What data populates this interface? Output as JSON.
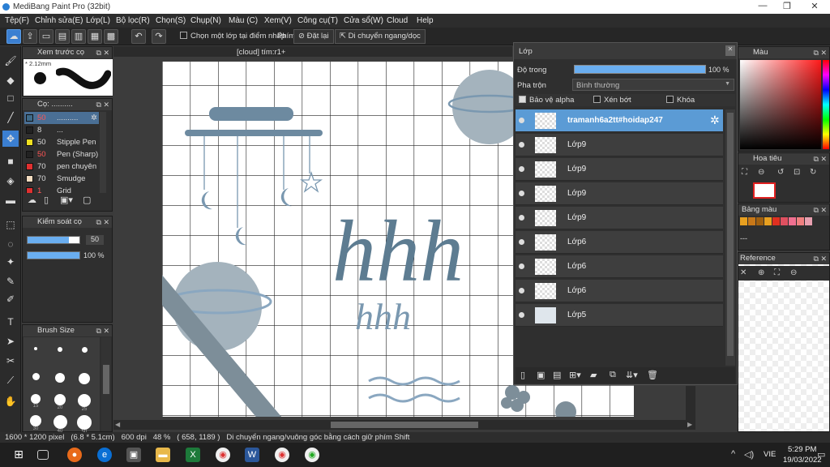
{
  "window": {
    "title": "MediBang Paint Pro (32bit)"
  },
  "menu": [
    "Tệp(F)",
    "Chỉnh sửa(E)",
    "Lớp(L)",
    "Bộ lọc(R)",
    "Chọn(S)",
    "Chụp(N)",
    "Màu (C)",
    "Xem(V)",
    "Công cụ(T)",
    "Cửa sổ(W)",
    "Cloud",
    "Help"
  ],
  "toolbar": {
    "select_layer_label": "Chọn một lớp tại điểm nhấp",
    "key_label": "Phím",
    "reset_label": "Đặt lại",
    "move_hv_label": "Di chuyển ngang/dọc"
  },
  "canvas": {
    "tab_title": "[cloud] tím:r1+"
  },
  "brush_preview": {
    "title": "Xem trước cọ",
    "size": "2.12mm"
  },
  "brush_panel": {
    "title": "Cọ: ..........",
    "items": [
      {
        "num": "50",
        "label": "..........",
        "color": "#3e6b8a",
        "selected": true
      },
      {
        "num": "8",
        "label": "...",
        "color": "#222222"
      },
      {
        "num": "50",
        "label": "Stipple Pen",
        "color": "#f0e020"
      },
      {
        "num": "50",
        "label": "Pen (Sharp)",
        "color": "#222222"
      },
      {
        "num": "70",
        "label": "pen chuyên",
        "color": "#e03030"
      },
      {
        "num": "70",
        "label": "Smudge",
        "color": "#f2dcc0"
      },
      {
        "num": "1",
        "label": "Grid",
        "color": "#e03030"
      }
    ]
  },
  "brush_control": {
    "title": "Kiểm soát cọ",
    "size": "50",
    "opacity": "100 %"
  },
  "brush_size": {
    "title": "Brush Size",
    "sizes": [
      "",
      "",
      "",
      "",
      "",
      "",
      "15",
      "20",
      "25",
      "30",
      "40",
      "50"
    ]
  },
  "layers": {
    "title": "Lớp",
    "opacity_label": "Độ trong",
    "opacity_value": "100 %",
    "blend_label": "Pha trộn",
    "blend_value": "Bình thường",
    "protect_alpha": "Bảo vệ alpha",
    "clipping": "Xén bớt",
    "lock": "Khóa",
    "items": [
      "tramanh6a2tt#hoidap247",
      "Lớp9",
      "Lớp9",
      "Lớp9",
      "Lớp9",
      "Lớp6",
      "Lớp6",
      "Lớp6",
      "Lớp5"
    ]
  },
  "right_panels": {
    "color": "Màu",
    "navigator": "Hoa tiêu",
    "palette": "Bảng màu",
    "palette_text": "---",
    "reference": "Reference"
  },
  "palette_colors": [
    "#e8a020",
    "#c87818",
    "#a06010",
    "#e03020",
    "#e05060",
    "#f07090",
    "#f08080",
    "#e8a0b0"
  ],
  "status": {
    "text": "1600 * 1200 pixel   (6.8 * 5.1cm)   600 dpi   48 %   ( 658, 1189 )   Di chuyển ngang/vuông góc bằng cách giữ phím Shift"
  },
  "taskbar": {
    "time": "5:29 PM",
    "date": "19/03/2022",
    "lang": "VIE"
  },
  "artwork": {
    "big_text": "hhh",
    "small_text": "hhh"
  }
}
